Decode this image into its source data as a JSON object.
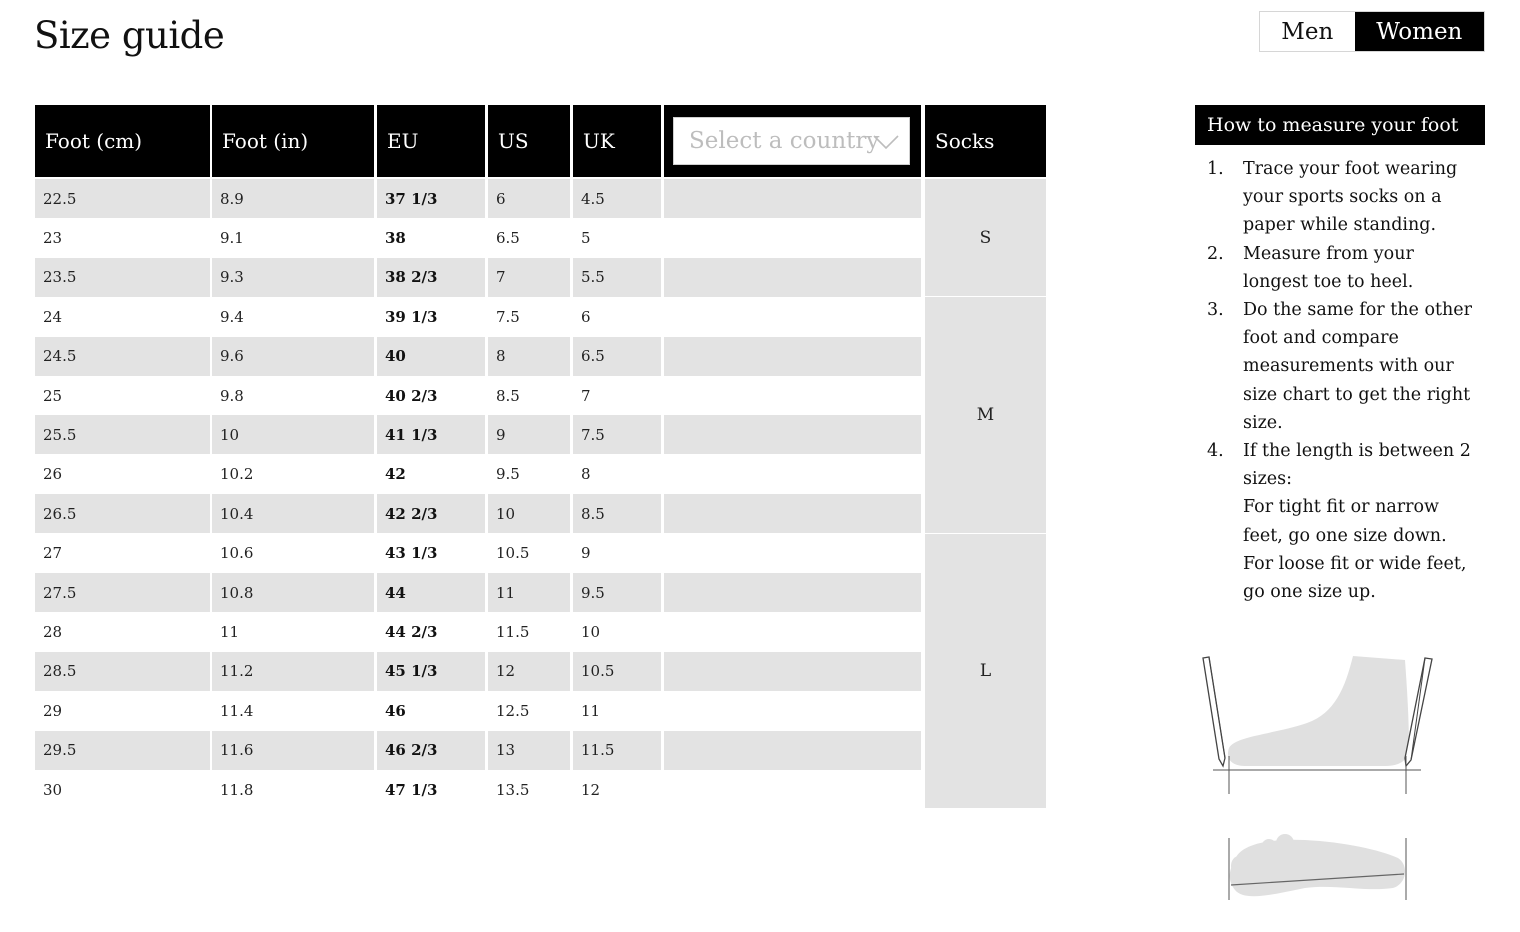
{
  "page": {
    "title": "Size guide"
  },
  "gender_toggle": {
    "men": "Men",
    "women": "Women",
    "selected": "Women"
  },
  "table": {
    "headers": [
      "Foot (cm)",
      "Foot (in)",
      "EU",
      "US",
      "UK"
    ],
    "country_select_placeholder": "Select a country",
    "socks_header": "Socks",
    "rows": [
      [
        "22.5",
        "8.9",
        "37 1/3",
        "6",
        "4.5"
      ],
      [
        "23",
        "9.1",
        "38",
        "6.5",
        "5"
      ],
      [
        "23.5",
        "9.3",
        "38 2/3",
        "7",
        "5.5"
      ],
      [
        "24",
        "9.4",
        "39 1/3",
        "7.5",
        "6"
      ],
      [
        "24.5",
        "9.6",
        "40",
        "8",
        "6.5"
      ],
      [
        "25",
        "9.8",
        "40 2/3",
        "8.5",
        "7"
      ],
      [
        "25.5",
        "10",
        "41 1/3",
        "9",
        "7.5"
      ],
      [
        "26",
        "10.2",
        "42",
        "9.5",
        "8"
      ],
      [
        "26.5",
        "10.4",
        "42 2/3",
        "10",
        "8.5"
      ],
      [
        "27",
        "10.6",
        "43 1/3",
        "10.5",
        "9"
      ],
      [
        "27.5",
        "10.8",
        "44",
        "11",
        "9.5"
      ],
      [
        "28",
        "11",
        "44 2/3",
        "11.5",
        "10"
      ],
      [
        "28.5",
        "11.2",
        "45 1/3",
        "12",
        "10.5"
      ],
      [
        "29",
        "11.4",
        "46",
        "12.5",
        "11"
      ],
      [
        "29.5",
        "11.6",
        "46 2/3",
        "13",
        "11.5"
      ],
      [
        "30",
        "11.8",
        "47 1/3",
        "13.5",
        "12"
      ]
    ],
    "socks": [
      {
        "label": "S",
        "row_count": 3
      },
      {
        "label": "M",
        "row_count": 6
      },
      {
        "label": "L",
        "row_count": 7
      }
    ]
  },
  "how_to": {
    "title": "How to measure your foot",
    "steps": [
      {
        "num": "1.",
        "text": "Trace your foot wearing your sports socks on a paper while standing."
      },
      {
        "num": "2.",
        "text": "Measure from your longest toe to heel."
      },
      {
        "num": "3.",
        "text": "Do the same for the other foot and compare measurements with our size chart to get the right size."
      },
      {
        "num": "4.",
        "text": "If the length is between 2 sizes:",
        "extra": "For tight fit or narrow feet, go one size down. For loose fit or wide feet, go one size up."
      }
    ]
  }
}
